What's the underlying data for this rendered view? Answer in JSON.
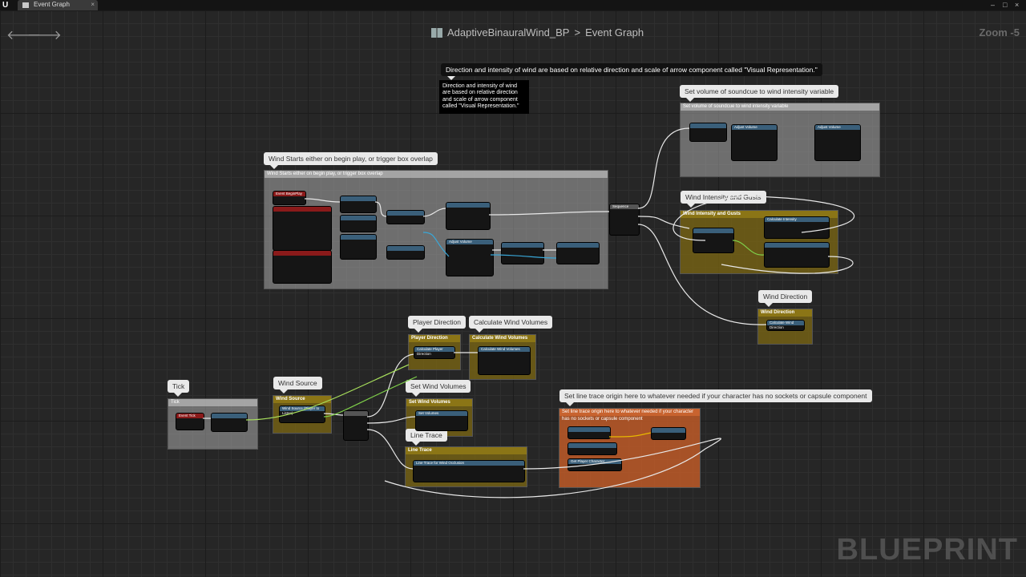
{
  "window": {
    "tab_label": "Event Graph",
    "close_glyph": "×",
    "controls": [
      "–",
      "□",
      "×"
    ]
  },
  "toolbar": {
    "back_glyph": "🡐",
    "forward_glyph": "🡒",
    "blueprint_name": "AdaptiveBinauralWind_BP",
    "separator": ">",
    "graph_name": "Event Graph",
    "zoom": "Zoom -5"
  },
  "watermark": "BLUEPRINT",
  "comments": {
    "tip_large": "Direction and intensity of wind are based on relative direction and scale of arrow component called \"Visual Representation.\"",
    "tip_small": "Direction and intensity of wind are based on relative direction and scale of arrow component called \"Visual Representation.\"",
    "set_volume": "Set volume of soundcue to wind intensity variable",
    "wind_starts": "Wind Starts either on begin play, or trigger box overlap",
    "wind_intensity": "Wind Intensity and Gusts",
    "wind_direction": "Wind Direction",
    "player_direction": "Player Direction",
    "calc_wind": "Calculate Wind Volumes",
    "tick": "Tick",
    "wind_source": "Wind Source",
    "set_wind": "Set Wind Volumes",
    "line_trace": "Line Trace",
    "line_origin": "Set line trace origin here to whatever needed if your character has no sockets or capsule component"
  },
  "nodes": {
    "event_tick": "Event Tick",
    "sequence": "Sequence",
    "event_begin_play": "Event BeginPlay",
    "set_volume_node": "Adjust Volume",
    "calc_intensity": "Calculate Intensity",
    "calc_direction": "Calculate Wind Direction",
    "line_trace_node": "Line Trace for Wind Occlusion",
    "wind_source_node": "Wind Source (Player to Listen)",
    "player_direction_node": "Calculate Player Direction",
    "calc_volumes_node": "Calculate Wind Volumes",
    "set_wind_node": "Set Volumes",
    "get_player_char": "Get Player Character"
  }
}
